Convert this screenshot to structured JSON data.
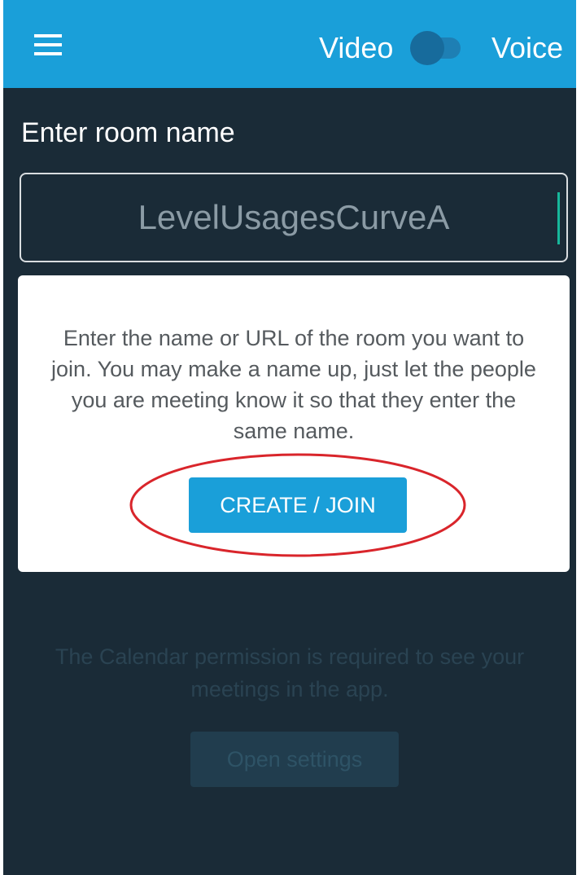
{
  "header": {
    "menu_icon": "hamburger-menu-icon",
    "video_label": "Video",
    "voice_label": "Voice"
  },
  "room": {
    "label": "Enter room name",
    "input_value": "LevelUsagesCurveA"
  },
  "card": {
    "help_text": "Enter the name or URL of the room you want to join. You may make a name up, just let the people you are meeting know it so that they enter the same name.",
    "join_label": "CREATE / JOIN"
  },
  "calendar": {
    "note": "The Calendar permission is required to see your meetings in the app.",
    "settings_label": "Open settings"
  },
  "colors": {
    "accent": "#1a9fd9",
    "background": "#1a2b37",
    "highlight_ring": "#d9252b"
  }
}
